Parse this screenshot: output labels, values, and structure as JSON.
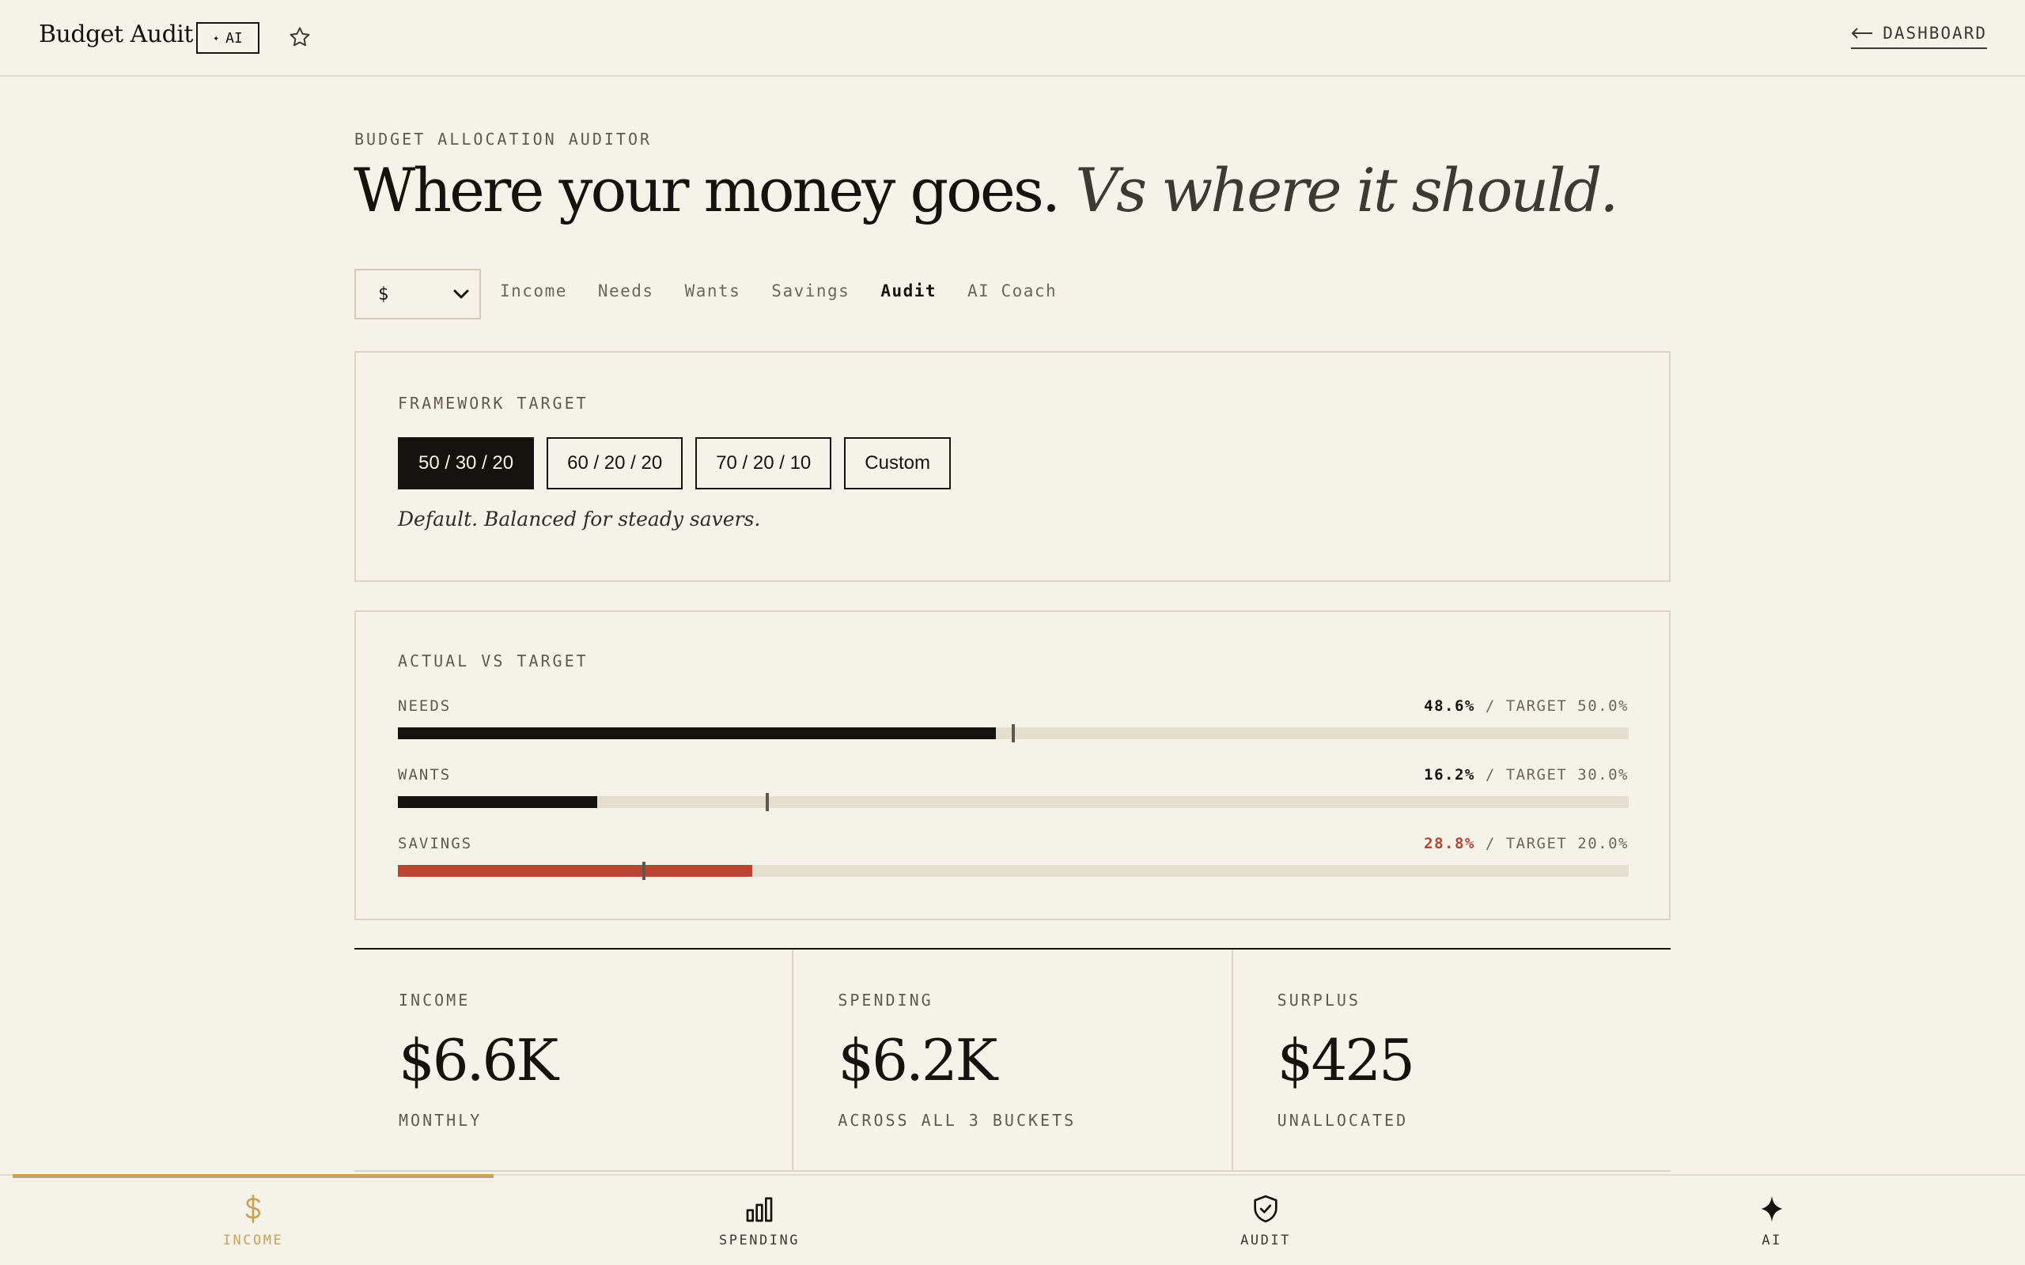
{
  "app": {
    "title": "Budget Audit",
    "ai_badge": "AI",
    "dashboard_link": "DASHBOARD"
  },
  "header": {
    "eyebrow": "BUDGET ALLOCATION AUDITOR",
    "headline": "Where your money goes.",
    "headline_accent": "Vs where it should."
  },
  "currency": {
    "selected": "$"
  },
  "tabs": [
    {
      "label": "Income"
    },
    {
      "label": "Needs"
    },
    {
      "label": "Wants"
    },
    {
      "label": "Savings"
    },
    {
      "label": "Audit",
      "active": true
    },
    {
      "label": "AI Coach"
    }
  ],
  "framework": {
    "label": "FRAMEWORK TARGET",
    "options": [
      {
        "label": "50 / 30 / 20",
        "selected": true
      },
      {
        "label": "60 / 20 / 20"
      },
      {
        "label": "70 / 20 / 10"
      },
      {
        "label": "Custom"
      }
    ],
    "description": "Default. Balanced for steady savers."
  },
  "actual_vs_target": {
    "label": "ACTUAL VS TARGET",
    "target_prefix": "/ TARGET",
    "rows": [
      {
        "name": "NEEDS",
        "actual": "48.6%",
        "target": "50.0%",
        "actual_pct": 48.6,
        "target_pct": 50.0,
        "over": false
      },
      {
        "name": "WANTS",
        "actual": "16.2%",
        "target": "30.0%",
        "actual_pct": 16.2,
        "target_pct": 30.0,
        "over": false
      },
      {
        "name": "SAVINGS",
        "actual": "28.8%",
        "target": "20.0%",
        "actual_pct": 28.8,
        "target_pct": 20.0,
        "over": true
      }
    ]
  },
  "stats": [
    {
      "label": "INCOME",
      "value": "$6.6K",
      "sub": "MONTHLY"
    },
    {
      "label": "SPENDING",
      "value": "$6.2K",
      "sub": "ACROSS ALL 3 BUCKETS"
    },
    {
      "label": "SURPLUS",
      "value": "$425",
      "sub": "UNALLOCATED"
    }
  ],
  "bottom_nav": [
    {
      "label": "INCOME",
      "icon": "dollar-icon",
      "active": true
    },
    {
      "label": "SPENDING",
      "icon": "bar-chart-icon"
    },
    {
      "label": "AUDIT",
      "icon": "shield-check-icon"
    },
    {
      "label": "AI",
      "icon": "sparkle-icon"
    }
  ],
  "colors": {
    "background": "#f5f2e9",
    "ink": "#141310",
    "accent_gold": "#c9a25a",
    "over_red": "#bb4530",
    "track": "#e4dece"
  }
}
